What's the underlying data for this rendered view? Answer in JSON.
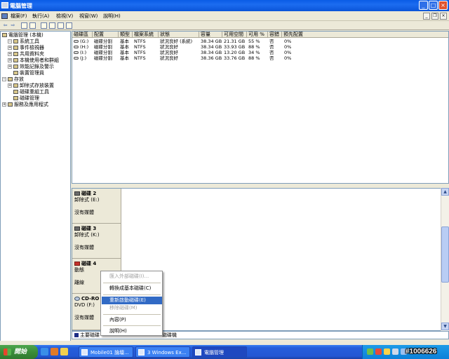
{
  "window": {
    "title": "電腦管理"
  },
  "menu": [
    "檔案(F)",
    "執行(A)",
    "檢視(V)",
    "視窗(W)",
    "說明(H)"
  ],
  "tree": {
    "root": "電腦管理 (本機)",
    "items": [
      {
        "label": "系統工具",
        "level": 1,
        "expander": "−"
      },
      {
        "label": "事件檢視器",
        "level": 2,
        "expander": "+"
      },
      {
        "label": "共用資料夾",
        "level": 2,
        "expander": "+"
      },
      {
        "label": "本機使用者和群組",
        "level": 2,
        "expander": "+"
      },
      {
        "label": "效能記錄及警示",
        "level": 2,
        "expander": "+"
      },
      {
        "label": "裝置管理員",
        "level": 2,
        "expander": ""
      },
      {
        "label": "存放",
        "level": 1,
        "expander": "−"
      },
      {
        "label": "卸除式存放裝置",
        "level": 2,
        "expander": "+"
      },
      {
        "label": "磁碟重組工具",
        "level": 2,
        "expander": ""
      },
      {
        "label": "磁碟管理",
        "level": 2,
        "expander": ""
      },
      {
        "label": "服務及應用程式",
        "level": 1,
        "expander": "+"
      }
    ]
  },
  "volumes": {
    "columns": [
      "磁碟區",
      "配置",
      "類型",
      "檔案系統",
      "狀態",
      "容量",
      "可用空間",
      "可用 %",
      "容錯",
      "預先配置"
    ],
    "rows": [
      [
        "(G:)",
        "磁碟分割",
        "基本",
        "NTFS",
        "狀況良好 (系統)",
        "38.34 GB",
        "21.31 GB",
        "55 %",
        "否",
        "0%"
      ],
      [
        "(H:)",
        "磁碟分割",
        "基本",
        "NTFS",
        "狀況良好",
        "38.34 GB",
        "33.93 GB",
        "88 %",
        "否",
        "0%"
      ],
      [
        "(I:)",
        "磁碟分割",
        "基本",
        "NTFS",
        "狀況良好",
        "38.34 GB",
        "13.20 GB",
        "34 %",
        "否",
        "0%"
      ],
      [
        "(J:)",
        "磁碟分割",
        "基本",
        "NTFS",
        "狀況良好",
        "38.36 GB",
        "33.76 GB",
        "88 %",
        "否",
        "0%"
      ]
    ]
  },
  "disks": [
    {
      "name": "磁碟 2",
      "type": "卸除式 (E:)",
      "media": "沒有媒體",
      "icon": "disk-icon"
    },
    {
      "name": "磁碟 3",
      "type": "卸除式 (K:)",
      "media": "沒有媒體",
      "icon": "disk-icon"
    },
    {
      "name": "磁碟 4",
      "type": "動態",
      "media": "離線",
      "icon": "disk-error-icon"
    },
    {
      "name": "CD-RO",
      "type": "DVD (F:)",
      "media": "沒有媒體",
      "icon": "cdrom-icon"
    }
  ],
  "context_menu": {
    "items": [
      {
        "label": "匯入外部磁碟(I)...",
        "disabled": true
      },
      {
        "label": "轉換成基本磁碟(C)",
        "disabled": false
      },
      {
        "label": "重新啟動磁碟(E)",
        "disabled": false,
        "selected": true
      },
      {
        "label": "移除磁碟(M)",
        "disabled": true
      },
      {
        "label": "內容(P)",
        "disabled": false
      },
      {
        "label": "說明(H)",
        "disabled": false
      }
    ]
  },
  "legend": {
    "primary": "主要磁碟",
    "other": "磁碟機"
  },
  "taskbar": {
    "start": "開始",
    "tasks": [
      "Mobile01 論壇...",
      "3 Windows Ex...",
      "電腦管理"
    ]
  },
  "watermark": "#1006626"
}
